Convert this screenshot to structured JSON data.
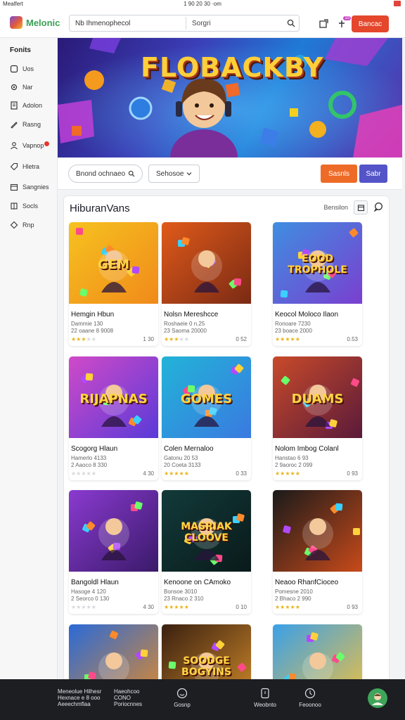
{
  "statusbar": {
    "left": "Mealfert",
    "center": "1 90 20 30 ·om"
  },
  "topbar": {
    "logo_text": "Melonic",
    "search_value": "Nb Ihmenophecol",
    "search_button": "Sorgri",
    "cta_label": "Bancac",
    "notif_badge": "10"
  },
  "sidebar": {
    "heading": "Fonits",
    "items": [
      {
        "label": "Uos",
        "icon": "square-icon"
      },
      {
        "label": "Nar",
        "icon": "gear-icon"
      },
      {
        "label": "Adolon",
        "icon": "document-icon"
      },
      {
        "label": "Rasng",
        "icon": "pen-icon"
      },
      {
        "label": "Vapnop",
        "icon": "person-icon",
        "badge": true
      },
      {
        "label": "Hletra",
        "icon": "tag-icon"
      },
      {
        "label": "Sangnies",
        "icon": "calendar-icon"
      },
      {
        "label": "Socls",
        "icon": "grid-icon"
      },
      {
        "label": "Rnp",
        "icon": "diamond-icon"
      }
    ]
  },
  "hero": {
    "title": "FLOBACKBY"
  },
  "filters": {
    "pill1": "Bnond ochnaeo",
    "pill2": "Sehosoe",
    "orange_button": "Sasnls",
    "purple_button": "Sabr"
  },
  "panel": {
    "title": "HiburanVans",
    "sort_label": "Bensilon"
  },
  "games": [
    {
      "title": "Hemgin Hbun",
      "line1": "Dammie 130",
      "line2": "22 oaane 8 9008",
      "rating": 3,
      "count": "1 30",
      "art": "GEM"
    },
    {
      "title": "Nolsn Mereshcce",
      "line1": "Roshaeie 0 n.25",
      "line2": "23 Saoma 20000",
      "rating": 3,
      "count": "0 52",
      "art": ""
    },
    {
      "title": "Keocol Moloco Ilaon",
      "line1": "Ronoare 7230",
      "line2": "23 boace 2000",
      "rating": 5,
      "count": "0.53",
      "art": "EOOD TROPHOLE"
    },
    {
      "title": "Scogorg Hlaun",
      "line1": "Hamerlo 4133",
      "line2": "2 Aaoco 8 330",
      "rating": 0,
      "count": "4 30",
      "art": "RIJAPNAS"
    },
    {
      "title": "Colen Mernaloo",
      "line1": "Gatonu 20 53",
      "line2": "20 Coeta 3133",
      "rating": 5,
      "count": "0 33",
      "art": "GOMES"
    },
    {
      "title": "Nolom Imbog Colanl",
      "line1": "Hanstao 6 93",
      "line2": "2 9aoroc 2 099",
      "rating": 5,
      "count": "0 93",
      "art": "DUAMS"
    },
    {
      "title": "Bangoldl Hlaun",
      "line1": "Hasoge 4 120",
      "line2": "2 Seorco 0 130",
      "rating": 0,
      "count": "4 30",
      "art": ""
    },
    {
      "title": "Kenoone on CAmoko",
      "line1": "Bonsoe 3010",
      "line2": "23 Rnaco 2 310",
      "rating": 5,
      "count": "0 10",
      "art": "MASRIAK CLOOVE"
    },
    {
      "title": "Neaoo RhanfCioceo",
      "line1": "Pomesne 2010",
      "line2": "2 Bhaco 2 990",
      "rating": 5,
      "count": "0 93",
      "art": ""
    },
    {
      "title": "",
      "line1": "",
      "line2": "",
      "rating": 0,
      "count": "",
      "art": ""
    },
    {
      "title": "",
      "line1": "",
      "line2": "",
      "rating": 0,
      "count": "",
      "art": "SOODGE BOGYINS"
    },
    {
      "title": "",
      "line1": "",
      "line2": "",
      "rating": 0,
      "count": "",
      "art": ""
    }
  ],
  "bottombar": {
    "promo_line1": "Meneolue Hilhesr",
    "promo_line2": "Hexnace e 8 ooo",
    "promo_line3": "Aeeechmflaa",
    "col2_line1": "Haeohcoo",
    "col2_line2": "CONO",
    "col2_line3": "Poriocnnes",
    "nav": [
      {
        "label": "Gosnp",
        "icon": "smile-icon"
      },
      {
        "label": "Weobnto",
        "icon": "phone-icon"
      },
      {
        "label": "Feoonoo",
        "icon": "clock-icon"
      }
    ]
  }
}
